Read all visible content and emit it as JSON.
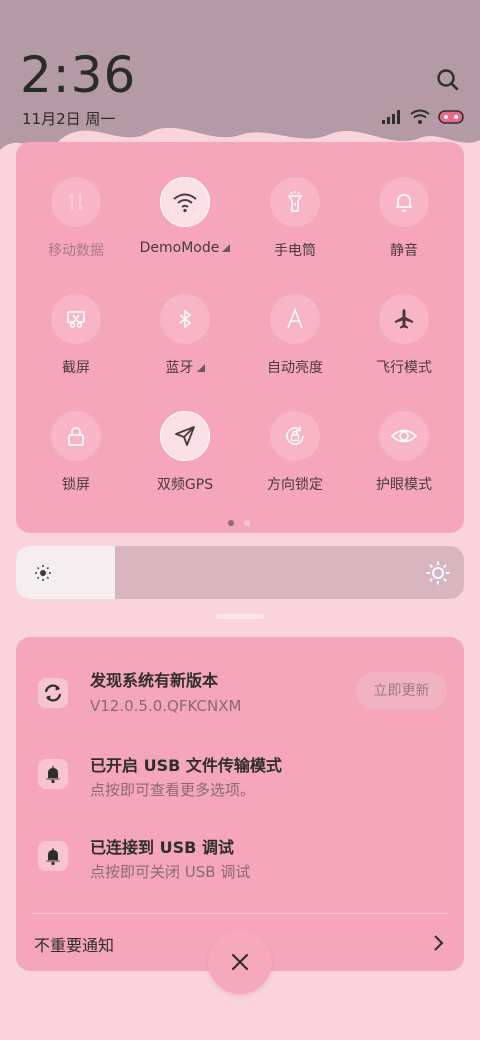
{
  "status": {
    "time": "2:36",
    "date": "11月2日 周一"
  },
  "colors": {
    "panel": "#f5a6ba",
    "background": "#fbd3dd",
    "wallpaper": "#b49aa4",
    "tile_active": "#fbe0e8"
  },
  "quick_settings": {
    "tiles": [
      {
        "label": "移动数据",
        "icon": "mobile-data-icon",
        "active": false,
        "disabled": true
      },
      {
        "label": "DemoMode",
        "icon": "wifi-icon",
        "active": true,
        "expandable": true
      },
      {
        "label": "手电筒",
        "icon": "flashlight-icon",
        "active": false
      },
      {
        "label": "静音",
        "icon": "bell-icon",
        "active": false
      },
      {
        "label": "截屏",
        "icon": "screenshot-icon",
        "active": false
      },
      {
        "label": "蓝牙",
        "icon": "bluetooth-icon",
        "active": false,
        "expandable": true
      },
      {
        "label": "自动亮度",
        "icon": "auto-brightness-icon",
        "active": false
      },
      {
        "label": "飞行模式",
        "icon": "airplane-icon",
        "active": false
      },
      {
        "label": "锁屏",
        "icon": "lock-icon",
        "active": false
      },
      {
        "label": "双频GPS",
        "icon": "location-arrow-icon",
        "active": true
      },
      {
        "label": "方向锁定",
        "icon": "rotation-lock-icon",
        "active": false
      },
      {
        "label": "护眼模式",
        "icon": "eye-icon",
        "active": false
      }
    ],
    "page_count": 2,
    "current_page": 1
  },
  "brightness": {
    "level": 0.22
  },
  "notifications": [
    {
      "title": "发现系统有新版本",
      "body": "V12.0.5.0.QFKCNXM",
      "icon": "sync-icon",
      "action": "立即更新"
    },
    {
      "title": "已开启 USB 文件传输模式",
      "body": "点按即可查看更多选项。",
      "icon": "bell-icon"
    },
    {
      "title": "已连接到 USB 调试",
      "body": "点按即可关闭 USB 调试",
      "icon": "bell-icon"
    }
  ],
  "footer": {
    "unimportant_label": "不重要通知"
  }
}
